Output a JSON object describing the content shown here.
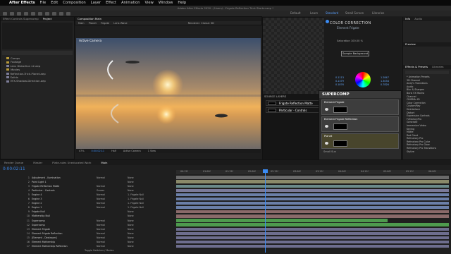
{
  "menubar": {
    "apple": "",
    "app": "After Effects",
    "items": [
      "File",
      "Edit",
      "Composition",
      "Layer",
      "Effect",
      "Animation",
      "View",
      "Window",
      "Help"
    ]
  },
  "titlebar": "Adobe After Effects 2020 - /Users/...Frigate Reflection Trick Starter.aep *",
  "workspaces": [
    "Default",
    "Learn",
    "Standard",
    "Small Screen",
    "Libraries"
  ],
  "project": {
    "tab1": "Effect Controls Supercomp",
    "tab2": "Project",
    "items": [
      {
        "type": "folder",
        "name": "Comps"
      },
      {
        "type": "folder",
        "name": "Footage"
      },
      {
        "type": "file",
        "name": "Lens Distortion v2.aep"
      },
      {
        "type": "folder",
        "name": "Movies"
      },
      {
        "type": "file",
        "name": "Reflection-Trick-Planet.aep"
      },
      {
        "type": "file",
        "name": "Solids"
      },
      {
        "type": "file",
        "name": "VFX-Shadow-Direction.aep"
      }
    ]
  },
  "viewer": {
    "tab": "Composition Main",
    "tabs2": [
      "Main",
      "Planet",
      "Frigate",
      "Lens Wave"
    ],
    "label": "Active Camera",
    "renderer": "Renderer: Classic 3D",
    "zoom": "47%",
    "time": "0:00:02:11",
    "quality": "Half",
    "camera": "Active Camera",
    "views": "1 View"
  },
  "source_layers": {
    "title": "SOURCE LAYERS",
    "layers": [
      "Frigate Reflection Matte",
      "Particular - Controls"
    ]
  },
  "color_correction": {
    "title": "COLOR CORRECTION",
    "subtitle": "Element Frigate",
    "saturation": "Saturation  100.00 %",
    "btn": "Sample Background",
    "values": [
      "0.1113",
      "0.1379",
      "0.1876",
      "1.2847",
      "1.3034",
      "0.7826"
    ]
  },
  "supercomp": {
    "title": "SUPERCOMP",
    "sections": [
      "Element Frigate",
      "Element Frigate Reflection",
      "Planet",
      "Small Sun"
    ]
  },
  "right": {
    "info": "Info",
    "audio": "Audio",
    "preview": "Preview",
    "effects": "Effects & Presets",
    "libraries": "Libraries",
    "list": [
      "* Animation Presets",
      "3D Channel",
      "Andy's Transitions",
      "Audio",
      "Blur & Sharpen",
      "Boris FX Mocha",
      "Channel",
      "CINEMA 4D",
      "Color Correction",
      "CustomPlay",
      "Deinterlace",
      "Distort",
      "Expression Controls",
      "FxFactoryPro",
      "Generate",
      "Immersive Video",
      "Keying",
      "Matte",
      "Red Giant",
      "Refractory Pro",
      "Refractory Pro Color",
      "Refractory Pro Glow",
      "Refractory Pro Transitions",
      "Stylize"
    ]
  },
  "timeline": {
    "tabs": [
      "Render Queue",
      "Master",
      "Plate-rules Uneducated Work",
      "Main"
    ],
    "time": "0:00:02:11",
    "ruler": [
      "00:12f",
      "01:00f",
      "01:12f",
      "02:00f",
      "02:12f",
      "03:00f",
      "03:12f",
      "04:00f",
      "04:12f",
      "05:00f",
      "05:12f",
      "06:00f"
    ],
    "layers": [
      {
        "n": "1",
        "name": "Adjustment - Ilumination",
        "mode": "Normal",
        "parent": "None"
      },
      {
        "n": "2",
        "name": "Point Light 1",
        "mode": "",
        "parent": "None"
      },
      {
        "n": "3",
        "name": "Frigate Reflection Matte",
        "mode": "Normal",
        "parent": "None"
      },
      {
        "n": "4",
        "name": "Particular - Controls",
        "mode": "Screen",
        "parent": "None"
      },
      {
        "n": "5",
        "name": "Engine 4",
        "mode": "Normal",
        "parent": "1. Frigate Null"
      },
      {
        "n": "6",
        "name": "Engine 3",
        "mode": "Normal",
        "parent": "1. Frigate Null"
      },
      {
        "n": "7",
        "name": "Engine 2",
        "mode": "Normal",
        "parent": "1. Frigate Null"
      },
      {
        "n": "8",
        "name": "Engine 1",
        "mode": "Normal",
        "parent": "1. Frigate Null"
      },
      {
        "n": "9",
        "name": "Frigate Null",
        "mode": "",
        "parent": "None"
      },
      {
        "n": "10",
        "name": "Mothership Null",
        "mode": "",
        "parent": "None"
      },
      {
        "n": "11",
        "name": "Supercomp",
        "mode": "Normal",
        "parent": "None"
      },
      {
        "n": "12",
        "name": "Supercomp",
        "mode": "Normal",
        "parent": "None"
      },
      {
        "n": "13",
        "name": "Element Frigate",
        "mode": "Normal",
        "parent": "None"
      },
      {
        "n": "14",
        "name": "Element Frigate Reflection",
        "mode": "Normal",
        "parent": "None"
      },
      {
        "n": "15",
        "name": "[Element - Destroyer]",
        "mode": "Normal",
        "parent": "None"
      },
      {
        "n": "16",
        "name": "Element Mothership",
        "mode": "Normal",
        "parent": "None"
      },
      {
        "n": "17",
        "name": "Element Mothership Reflection",
        "mode": "Normal",
        "parent": "None"
      }
    ],
    "footer": "Toggle Switches / Modes"
  }
}
